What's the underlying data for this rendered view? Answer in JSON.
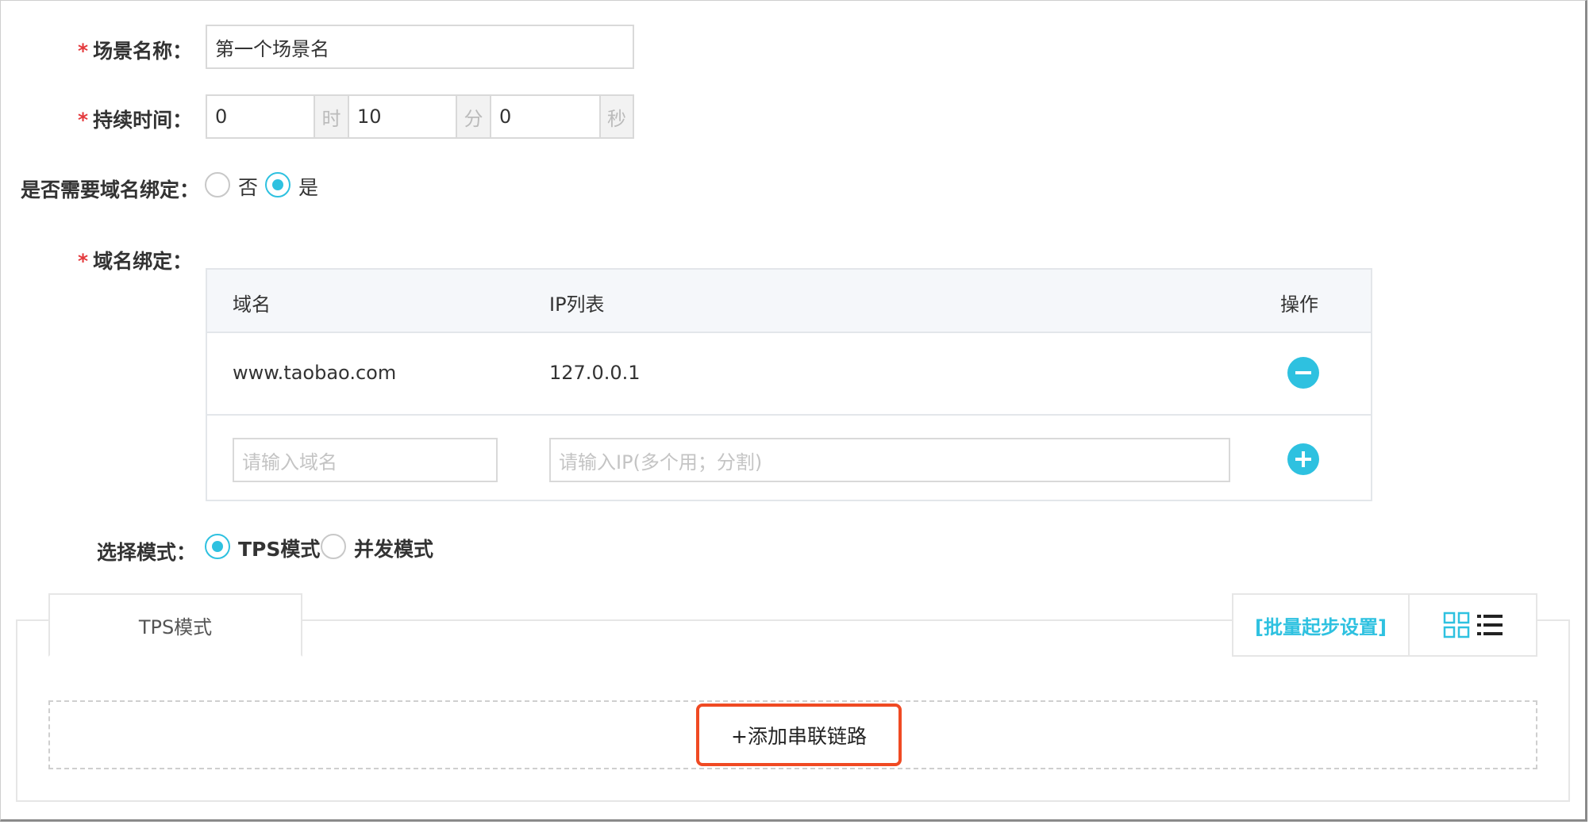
{
  "form": {
    "scene_name": {
      "label": "场景名称：",
      "value": "第一个场景名"
    },
    "duration": {
      "label": "持续时间：",
      "hours": "0",
      "hour_unit": "时",
      "minutes": "10",
      "minute_unit": "分",
      "seconds": "0",
      "second_unit": "秒"
    },
    "domain_binding_needed": {
      "label": "是否需要域名绑定：",
      "option_no": "否",
      "option_yes": "是",
      "selected": "是"
    },
    "domain_binding": {
      "label": "域名绑定：",
      "columns": [
        "域名",
        "IP列表",
        "操作"
      ],
      "rows": [
        {
          "domain": "www.taobao.com",
          "ip": "127.0.0.1"
        }
      ],
      "domain_placeholder": "请输入域名",
      "ip_placeholder": "请输入IP(多个用；分割)"
    },
    "mode": {
      "label": "选择模式：",
      "option_tps": "TPS模式",
      "option_concurrent": "并发模式",
      "selected": "TPS模式"
    }
  },
  "panel": {
    "tab_label": "TPS模式",
    "batch_settings_link": "[批量起步设置]",
    "add_chain_button": "+添加串联链路"
  },
  "colors": {
    "accent": "#2ec1e0",
    "required_star": "#e4393c",
    "highlight_border": "#f04a23"
  }
}
